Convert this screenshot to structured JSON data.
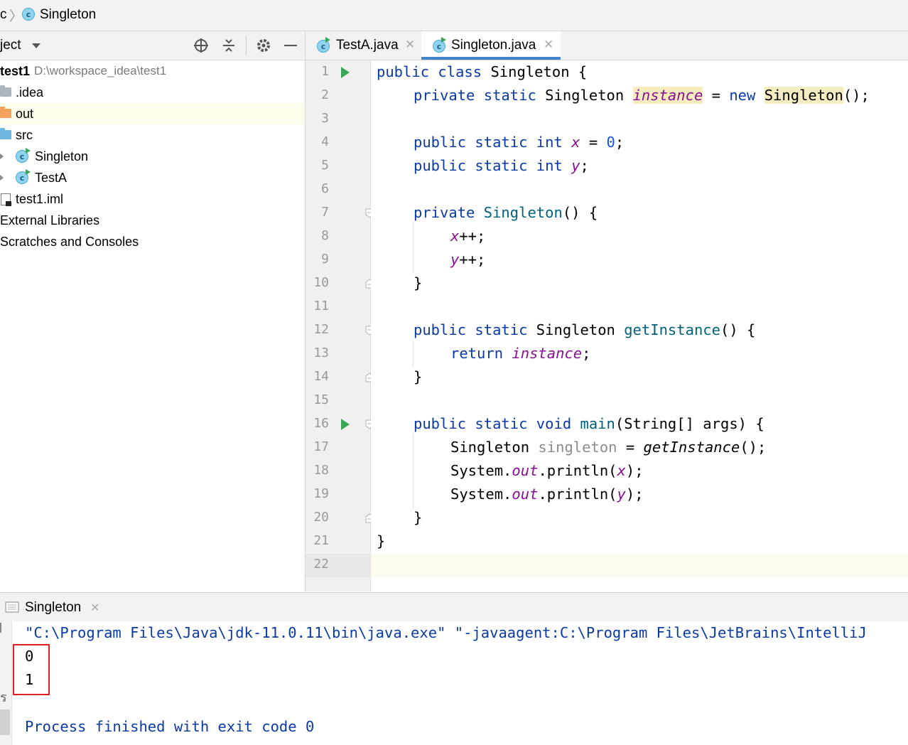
{
  "breadcrumb": {
    "items": [
      "c",
      "Singleton"
    ]
  },
  "project_panel": {
    "title": "ject",
    "tree": [
      {
        "label": "test1",
        "path": "D:\\workspace_idea\\test1"
      },
      {
        "label": ".idea"
      },
      {
        "label": "out"
      },
      {
        "label": "src"
      },
      {
        "label": "Singleton"
      },
      {
        "label": "TestA"
      },
      {
        "label": "test1.iml"
      },
      {
        "label": "External Libraries"
      },
      {
        "label": "Scratches and Consoles"
      }
    ]
  },
  "editor": {
    "tabs": [
      {
        "label": "TestA.java",
        "active": false
      },
      {
        "label": "Singleton.java",
        "active": true
      }
    ],
    "line_numbers": [
      "1",
      "2",
      "3",
      "4",
      "5",
      "6",
      "7",
      "8",
      "9",
      "10",
      "11",
      "12",
      "13",
      "14",
      "15",
      "16",
      "17",
      "18",
      "19",
      "20",
      "21",
      "22"
    ],
    "code": {
      "l1_kw": "public class ",
      "l1_rest": "Singleton {",
      "l2_kw": "private static ",
      "l2_type": "Singleton ",
      "l2_field": "instance",
      "l2_eq": " = ",
      "l2_new": "new ",
      "l2_cls": "Singleton",
      "l2_end": "();",
      "l4_kw": "public static int ",
      "l4_field": "x",
      "l4_eq": " = ",
      "l4_num": "0",
      "l4_end": ";",
      "l5_kw": "public static int ",
      "l5_field": "y",
      "l5_end": ";",
      "l7_kw": "private ",
      "l7_name": "Singleton",
      "l7_end": "() {",
      "l8_field": "x",
      "l8_end": "++;",
      "l9_field": "y",
      "l9_end": "++;",
      "l10": "}",
      "l12_kw": "public static ",
      "l12_type": "Singleton ",
      "l12_name": "getInstance",
      "l12_end": "() {",
      "l13_kw": "return ",
      "l13_field": "instance",
      "l13_end": ";",
      "l14": "}",
      "l16_kw": "public static void ",
      "l16_name": "main",
      "l16_end": "(String[] args) {",
      "l17_type": "Singleton ",
      "l17_var": "singleton",
      "l17_eq": " = ",
      "l17_call": "getInstance",
      "l17_end": "();",
      "l18_a": "System.",
      "l18_out": "out",
      "l18_b": ".println(",
      "l18_arg": "x",
      "l18_c": ");",
      "l19_a": "System.",
      "l19_out": "out",
      "l19_b": ".println(",
      "l19_arg": "y",
      "l19_c": ");",
      "l20": "}",
      "l21": "}"
    }
  },
  "run_panel": {
    "tab_label": "Singleton",
    "command": "\"C:\\Program Files\\Java\\jdk-11.0.11\\bin\\java.exe\" \"-javaagent:C:\\Program Files\\JetBrains\\IntelliJ",
    "output": [
      "0",
      "1"
    ],
    "exit_message": "Process finished with exit code 0"
  },
  "colors": {
    "keyword": "#0a3aa3",
    "field": "#871094",
    "method": "#00627a",
    "run_arrow": "#3aa557",
    "highlight_box": "#e02020"
  }
}
